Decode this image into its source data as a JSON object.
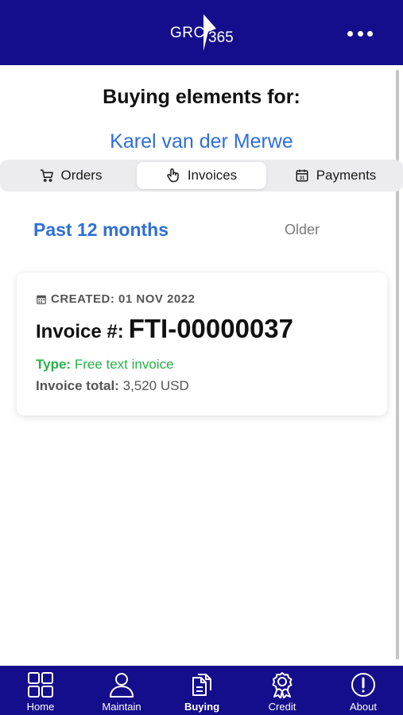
{
  "header": {
    "logo_left": "GRC",
    "logo_right": "365",
    "menu_icon": "more-horizontal-icon"
  },
  "main": {
    "heading": "Buying elements for:",
    "customer_name": "Karel van der Merwe"
  },
  "segments": [
    {
      "label": "Orders",
      "icon": "cart-icon",
      "active": false
    },
    {
      "label": "Invoices",
      "icon": "hand-document-icon",
      "active": true
    },
    {
      "label": "Payments",
      "icon": "calendar-31-icon",
      "active": false
    }
  ],
  "period_tabs": {
    "past": "Past 12 months",
    "older": "Older"
  },
  "invoice_card": {
    "created": "CREATED: 01 NOV 2022",
    "invoice_prefix": "Invoice #:",
    "invoice_number": "FTI-00000037",
    "type_label": "Type:",
    "type_value": "Free text invoice",
    "total_label": "Invoice total:",
    "total_value": "3,520 USD"
  },
  "bottom_nav": [
    {
      "label": "Home",
      "icon": "grid-icon"
    },
    {
      "label": "Maintain",
      "icon": "person-icon"
    },
    {
      "label": "Buying",
      "icon": "documents-icon",
      "active": true
    },
    {
      "label": "Credit",
      "icon": "award-icon"
    },
    {
      "label": "About",
      "icon": "info-alert-icon"
    }
  ],
  "colors": {
    "brand_navy": "#150e8c",
    "accent_blue": "#2f6fd9",
    "type_green": "#27b24a"
  }
}
